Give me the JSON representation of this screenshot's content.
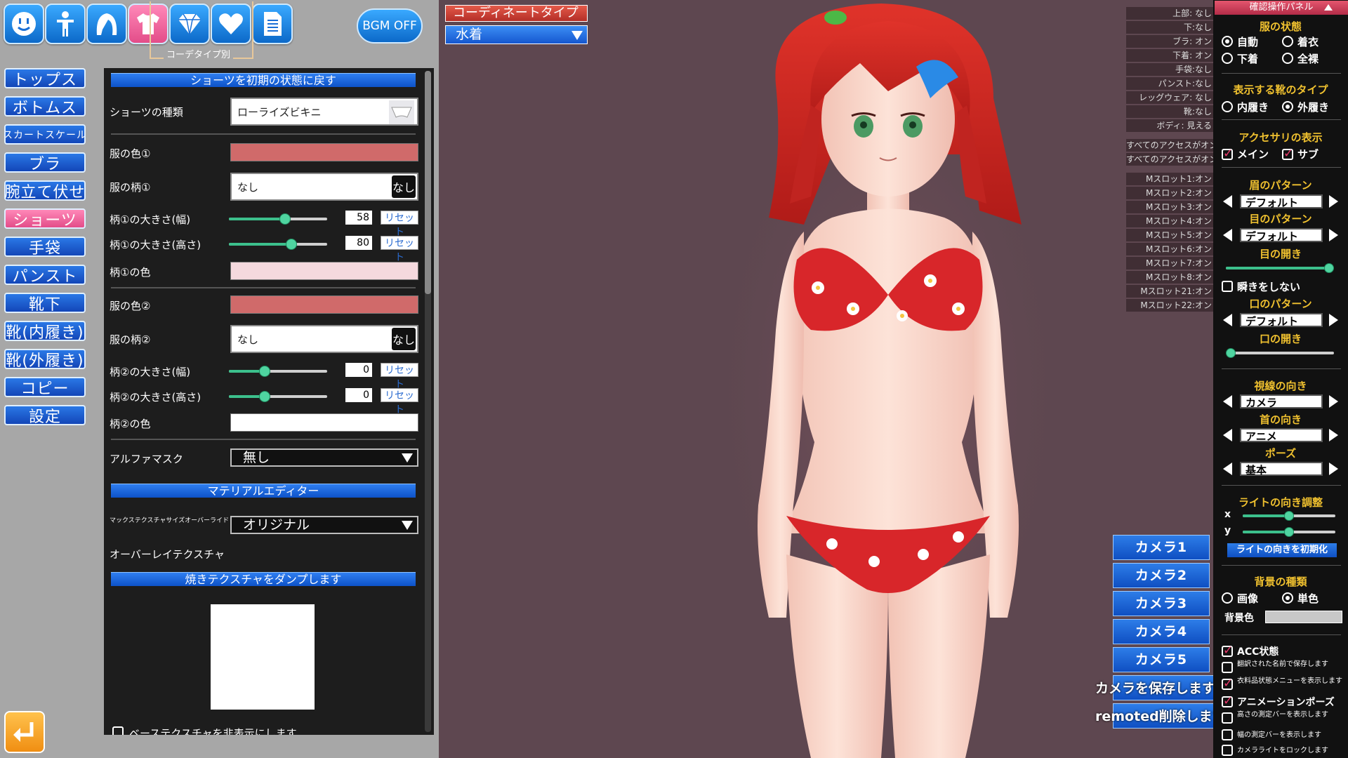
{
  "top_bar": {
    "icons": [
      "face-icon",
      "body-icon",
      "hair-icon",
      "clothes-icon",
      "accessory-icon",
      "heart-icon",
      "document-icon"
    ],
    "selected_index": 3,
    "bgm_label": "BGM OFF",
    "selected_caption": "コーデタイプ別"
  },
  "left_nav": {
    "items": [
      "トップス",
      "ボトムス",
      "スカートスケール",
      "ブラ",
      "腕立て伏せ",
      "ショーツ",
      "手袋",
      "パンスト",
      "靴下",
      "靴(内履き)",
      "靴(外履き)",
      "コピー",
      "設定"
    ],
    "selected": "ショーツ"
  },
  "panel": {
    "reset_header": "ショーツを初期の状態に戻す",
    "type_label": "ショーツの種類",
    "type_value": "ローライズビキニ",
    "color1_label": "服の色①",
    "color1": "#d06a6a",
    "pattern1_label": "服の柄①",
    "pattern1_value": "なし",
    "pattern1_btn": "なし",
    "p1_width_label": "柄①の大きさ(幅)",
    "p1_width_value": "58",
    "p1_width_level": 0.58,
    "p1_height_label": "柄①の大きさ(高さ)",
    "p1_height_value": "80",
    "p1_height_level": 0.65,
    "reset_label": "リセット",
    "p1_color_label": "柄①の色",
    "p1_color": "#f5d9de",
    "color2_label": "服の色②",
    "color2": "#d06a6a",
    "pattern2_label": "服の柄②",
    "pattern2_value": "なし",
    "pattern2_btn": "なし",
    "p2_width_label": "柄②の大きさ(幅)",
    "p2_width_value": "0",
    "p2_width_level": 0.35,
    "p2_height_label": "柄②の大きさ(高さ)",
    "p2_height_value": "0",
    "p2_height_level": 0.35,
    "p2_color_label": "柄②の色",
    "p2_color": "#ffffff",
    "alpha_label": "アルファマスク",
    "alpha_value": "無し",
    "material_header": "マテリアルエディター",
    "max_tex_label": "マックステクスチャサイズオーバーライド",
    "max_tex_value": "オリジナル",
    "overlay_label": "オーバーレイテクスチャ",
    "dump_header": "焼きテクスチャをダンプします",
    "hide_base_label": "ベーステクスチャを非表示にします"
  },
  "coordinate": {
    "header": "コーディネートタイプ",
    "value": "水着"
  },
  "status_list": {
    "items": [
      "上部: なし",
      "下:なし",
      "ブラ: オン",
      "下着: オン",
      "手袋:なし",
      "パンスト:なし",
      "レッグウェア: なし",
      "靴:なし",
      "ボディ: 見える"
    ],
    "acc_items": [
      "すべてのアクセスがオン",
      "すべてのアクセスがオン"
    ],
    "slot_items": [
      "Mスロット1:オン",
      "Mスロット2:オン",
      "Mスロット3:オン",
      "Mスロット4:オン",
      "Mスロット5:オン",
      "Mスロット6:オン",
      "Mスロット7:オン",
      "Mスロット8:オン",
      "Mスロット21:オン",
      "Mスロット22:オン"
    ]
  },
  "cameras": {
    "buttons": [
      "カメラ1",
      "カメラ2",
      "カメラ3",
      "カメラ4",
      "カメラ5"
    ],
    "save_label": "カメラを保存します",
    "remote_label": "remoted削除します"
  },
  "right_panel": {
    "title": "確認操作パネル",
    "clothes_state_hdr": "服の状態",
    "clothes_opts": [
      "自動",
      "着衣",
      "下着",
      "全裸"
    ],
    "clothes_selected": "自動",
    "shoe_hdr": "表示する靴のタイプ",
    "shoe_opts": [
      "内履き",
      "外履き"
    ],
    "shoe_selected": "外履き",
    "acc_hdr": "アクセサリの表示",
    "acc_main": "メイン",
    "acc_sub": "サブ",
    "brow_hdr": "眉のパターン",
    "brow_value": "デフォルト",
    "eye_hdr": "目のパターン",
    "eye_value": "デフォルト",
    "eye_open_hdr": "目の開き",
    "eye_open_level": 1.0,
    "no_blink": "瞬きをしない",
    "mouth_hdr": "口のパターン",
    "mouth_value": "デフォルト",
    "mouth_open_hdr": "口の開き",
    "mouth_open_level": 0.0,
    "gaze_hdr": "視線の向き",
    "gaze_value": "カメラ",
    "neck_hdr": "首の向き",
    "neck_value": "アニメ",
    "pose_hdr": "ポーズ",
    "pose_value": "基本",
    "light_hdr": "ライトの向き調整",
    "light_x": "x",
    "light_y": "y",
    "light_x_level": 0.5,
    "light_y_level": 0.5,
    "light_reset": "ライトの向きを初期化",
    "bg_hdr": "背景の種類",
    "bg_opts": [
      "画像",
      "単色"
    ],
    "bg_selected": "単色",
    "bg_color_label": "背景色",
    "bg_color": "#c8c8c8",
    "acc_state": "ACC状態",
    "opt1": "翻訳された名前で保存します",
    "opt2": "衣料品状態メニューを表示します",
    "opt3": "アニメーションポーズ",
    "opt4": "高さの測定バーを表示します",
    "opt5": "幅の測定バーを表示します",
    "opt6": "カメラライトをロックします"
  },
  "colors": {
    "background": "#5e4750",
    "accent_blue": "#1a5fd4",
    "accent_pink": "#e34d89",
    "header_yellow": "#f0c12f"
  }
}
